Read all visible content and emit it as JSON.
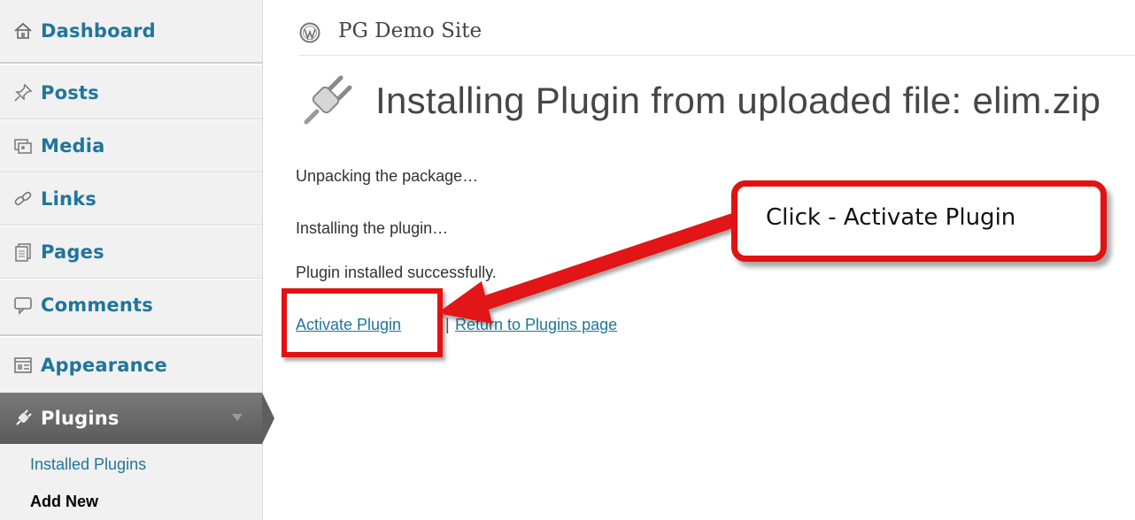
{
  "sidebar": {
    "items": [
      {
        "label": "Dashboard",
        "icon": "home-icon"
      },
      {
        "label": "Posts",
        "icon": "pushpin-icon"
      },
      {
        "label": "Media",
        "icon": "media-icon"
      },
      {
        "label": "Links",
        "icon": "link-icon"
      },
      {
        "label": "Pages",
        "icon": "pages-icon"
      },
      {
        "label": "Comments",
        "icon": "comment-icon"
      },
      {
        "label": "Appearance",
        "icon": "appearance-icon"
      },
      {
        "label": "Plugins",
        "icon": "plug-icon",
        "active": true
      }
    ],
    "submenu": {
      "installed": "Installed Plugins",
      "add_new": "Add New"
    }
  },
  "header": {
    "site_name": "PG Demo Site"
  },
  "main": {
    "title": "Installing Plugin from uploaded file: elim.zip",
    "messages": [
      "Unpacking the package…",
      "Installing the plugin…",
      "Plugin installed successfully."
    ],
    "links": {
      "activate": "Activate Plugin",
      "separator": "|",
      "return": "Return to Plugins page"
    }
  },
  "annotation": {
    "callout": "Click - Activate Plugin",
    "color": "#e21212"
  },
  "colors": {
    "link": "#21759b",
    "sidebar_bg": "#f1f1f1",
    "active_menu_bg": "#5f5f5f"
  }
}
